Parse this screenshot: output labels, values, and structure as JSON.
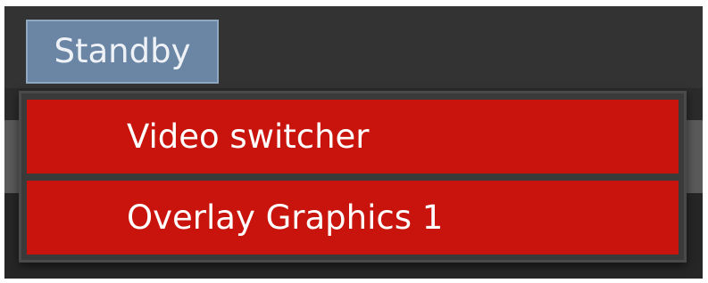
{
  "colors": {
    "background": "#2b2b2b",
    "button_bg": "#6b86a4",
    "button_border": "#8fa7c0",
    "item_bg": "#c8140c",
    "dropdown_border": "#4a4a4a"
  },
  "standby_button": {
    "label": "Standby"
  },
  "dropdown": {
    "items": [
      {
        "label": "Video switcher"
      },
      {
        "label": "Overlay Graphics 1"
      }
    ]
  }
}
